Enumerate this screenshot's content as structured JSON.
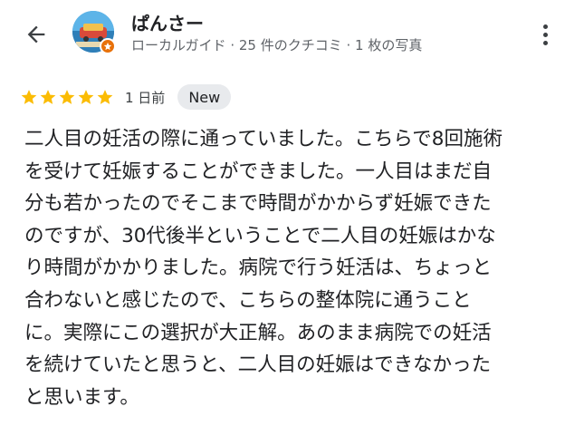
{
  "header": {
    "back_icon": "arrow-back-icon",
    "reviewer_name": "ぱんさー",
    "reviewer_meta": "ローカルガイド · 25 件のクチコミ · 1 枚の写真",
    "badge_icon": "local-guide-star-icon",
    "more_icon": "more-vert-icon"
  },
  "rating": {
    "stars": 5,
    "max_stars": 5,
    "star_color": "#fbbc04",
    "time_ago": "1 日前",
    "new_label": "New"
  },
  "review": {
    "lines": [
      "二人目の妊活の際に通っていました。こちらで8回施術",
      "を受けて妊娠することができました。一人目はまだ自",
      "分も若かったのでそこまで時間がかからず妊娠できた",
      "のですが、30代後半ということで二人目の妊娠はかな",
      "り時間がかかりました。病院で行う妊活は、ちょっと",
      "合わないと感じたので、こちらの整体院に通うこと",
      "に。実際にこの選択が大正解。あのまま病院での妊活",
      "を続けていたと思うと、二人目の妊娠はできなかった",
      "と思います。"
    ]
  },
  "colors": {
    "text": "#202124",
    "meta": "#5f6368",
    "badge_bg": "#e8eaed",
    "local_guide": "#e8710a"
  }
}
